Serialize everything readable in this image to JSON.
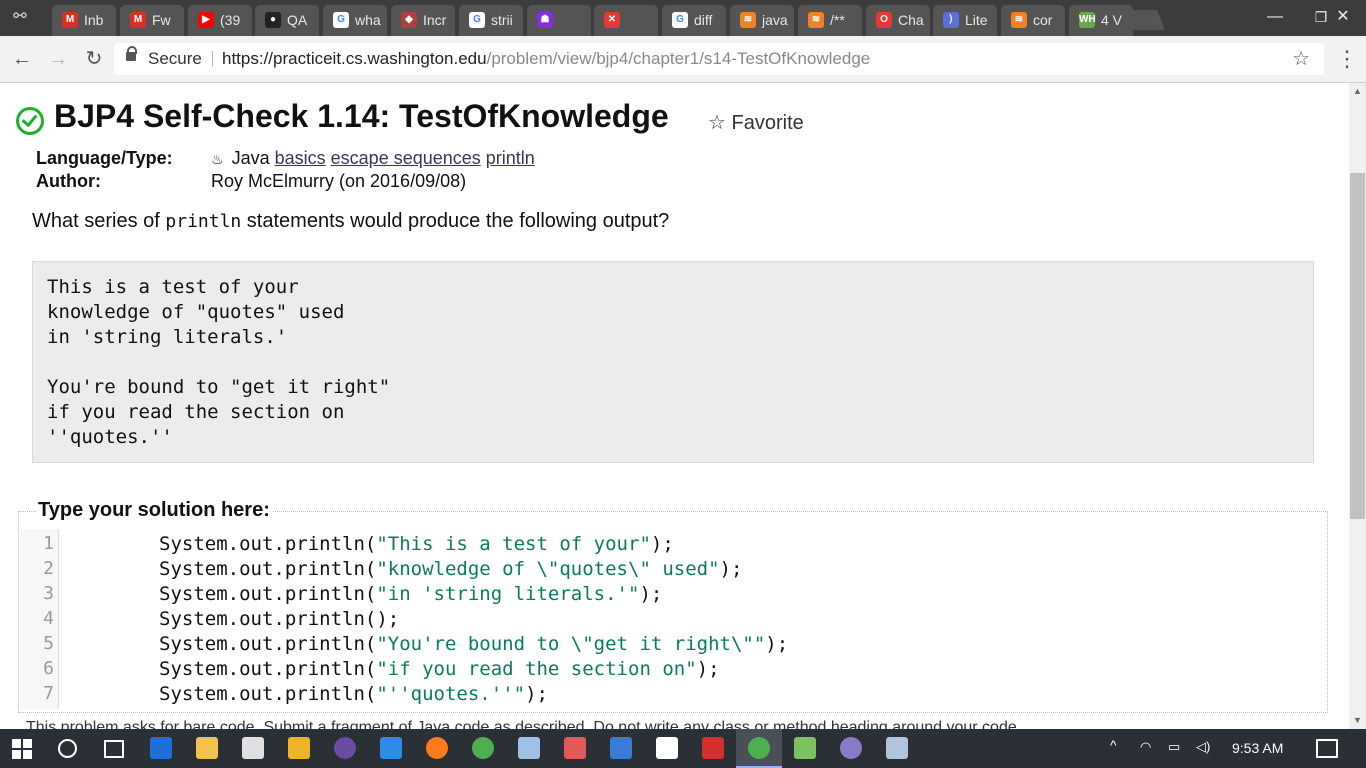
{
  "browser": {
    "tabs": [
      {
        "label": "Inb",
        "icon": "gmail-icon",
        "color": "#d93025",
        "glyph": "M"
      },
      {
        "label": "Fw",
        "icon": "gmail-icon",
        "color": "#d93025",
        "glyph": "M"
      },
      {
        "label": "(39",
        "icon": "youtube-icon",
        "color": "#ff0000",
        "glyph": "▶"
      },
      {
        "label": "QA",
        "icon": "github-icon",
        "color": "#222222",
        "glyph": "●"
      },
      {
        "label": "wha",
        "icon": "google-icon",
        "color": "#ffffff",
        "glyph": "G"
      },
      {
        "label": "Incr",
        "icon": "package-icon",
        "color": "#b04040",
        "glyph": "◆"
      },
      {
        "label": "strii",
        "icon": "google-icon",
        "color": "#ffffff",
        "glyph": "G"
      },
      {
        "label": "",
        "icon": "purple-character-icon",
        "color": "#8a2be2",
        "glyph": "☗"
      },
      {
        "label": "",
        "icon": "close-tab-icon",
        "color": "#e53935",
        "glyph": "✕"
      },
      {
        "label": "diff",
        "icon": "google-icon",
        "color": "#ffffff",
        "glyph": "G"
      },
      {
        "label": "java",
        "icon": "stackoverflow-icon",
        "color": "#f48024",
        "glyph": "≋"
      },
      {
        "label": "/**",
        "icon": "stackoverflow-icon",
        "color": "#f48024",
        "glyph": "≋"
      },
      {
        "label": "Cha",
        "icon": "opera-icon",
        "color": "#e53935",
        "glyph": "O"
      },
      {
        "label": "Lite",
        "icon": "litera-icon",
        "color": "#5a6fd8",
        "glyph": "⟩"
      },
      {
        "label": "cor",
        "icon": "stackoverflow-icon",
        "color": "#f48024",
        "glyph": "≋"
      },
      {
        "label": "4 V",
        "icon": "wh-icon",
        "color": "#6aa84f",
        "glyph": "WH"
      }
    ],
    "window_controls": {
      "minimize": "—",
      "restore": "❐",
      "close": "✕"
    },
    "nav": {
      "back": "←",
      "forward": "→",
      "reload": "↻"
    },
    "address": {
      "secure_label": "Secure",
      "url_host": "https://practiceit.cs.washington.edu",
      "url_path": "/problem/view/bjp4/chapter1/s14-TestOfKnowledge"
    },
    "star": "☆",
    "menu": "⋮"
  },
  "page": {
    "title": "BJP4 Self-Check 1.14: TestOfKnowledge",
    "favorite_label": "Favorite",
    "favorite_star": "☆",
    "meta": {
      "language_label": "Language/Type:",
      "language_value": "Java",
      "java_glyph": "♨",
      "tags": [
        "basics",
        "escape sequences",
        "println"
      ],
      "author_label": "Author:",
      "author_value": "Roy McElmurry (on 2016/09/08)"
    },
    "question": {
      "prefix": "What series of ",
      "code": "println",
      "suffix": " statements would produce the following output?"
    },
    "expected_output": [
      "This is a test of your",
      "knowledge of \"quotes\" used",
      "in 'string literals.'",
      "",
      "You're bound to \"get it right\"",
      "if you read the section on",
      "''quotes.''"
    ],
    "solution_legend": "Type your solution here:",
    "solution_lines": [
      {
        "num": "1",
        "pre": "System.out.println(",
        "str": "\"This is a test of your\"",
        "post": ");"
      },
      {
        "num": "2",
        "pre": "System.out.println(",
        "str": "\"knowledge of \\\"quotes\\\" used\"",
        "post": ");"
      },
      {
        "num": "3",
        "pre": "System.out.println(",
        "str": "\"in 'string literals.'\"",
        "post": ");"
      },
      {
        "num": "4",
        "pre": "System.out.println();",
        "str": "",
        "post": ""
      },
      {
        "num": "5",
        "pre": "System.out.println(",
        "str": "\"You're bound to \\\"get it right\\\"\"",
        "post": ");"
      },
      {
        "num": "6",
        "pre": "System.out.println(",
        "str": "\"if you read the section on\"",
        "post": ");"
      },
      {
        "num": "7",
        "pre": "System.out.println(",
        "str": "\"''quotes.''\"",
        "post": ");"
      }
    ],
    "footer_note": "This problem asks for bare code. Submit a fragment of Java code as described. Do not write any class or method heading around your code."
  },
  "taskbar": {
    "clock": "9:53 AM",
    "tray": {
      "wifi": "◠",
      "battery": "▭",
      "volume": "◁)",
      "arrow": "^"
    },
    "apps": [
      {
        "name": "edge-icon",
        "color": "#1e6fd9"
      },
      {
        "name": "file-explorer-icon",
        "color": "#f2c14e"
      },
      {
        "name": "store-icon",
        "color": "#e0e0e0"
      },
      {
        "name": "calculator-grid-icon",
        "color": "#f0b429"
      },
      {
        "name": "eclipse-icon",
        "color": "#6a4ca0"
      },
      {
        "name": "internet-explorer-icon",
        "color": "#2d8ce8"
      },
      {
        "name": "firefox-icon",
        "color": "#ff7a1a"
      },
      {
        "name": "chrome-icon",
        "color": "#4caf50"
      },
      {
        "name": "photos-icon",
        "color": "#9ec1e8"
      },
      {
        "name": "paint-icon",
        "color": "#e05a5a"
      },
      {
        "name": "download-icon",
        "color": "#3a7bd5"
      },
      {
        "name": "mail-icon",
        "color": "#ffffff"
      },
      {
        "name": "acrobat-icon",
        "color": "#d32f2f"
      },
      {
        "name": "chrome-active-icon",
        "color": "#4caf50"
      },
      {
        "name": "git-icon",
        "color": "#7cc15f"
      },
      {
        "name": "eclipse-2-icon",
        "color": "#8a7bc8"
      },
      {
        "name": "tool-icon",
        "color": "#b0c4de"
      }
    ]
  }
}
